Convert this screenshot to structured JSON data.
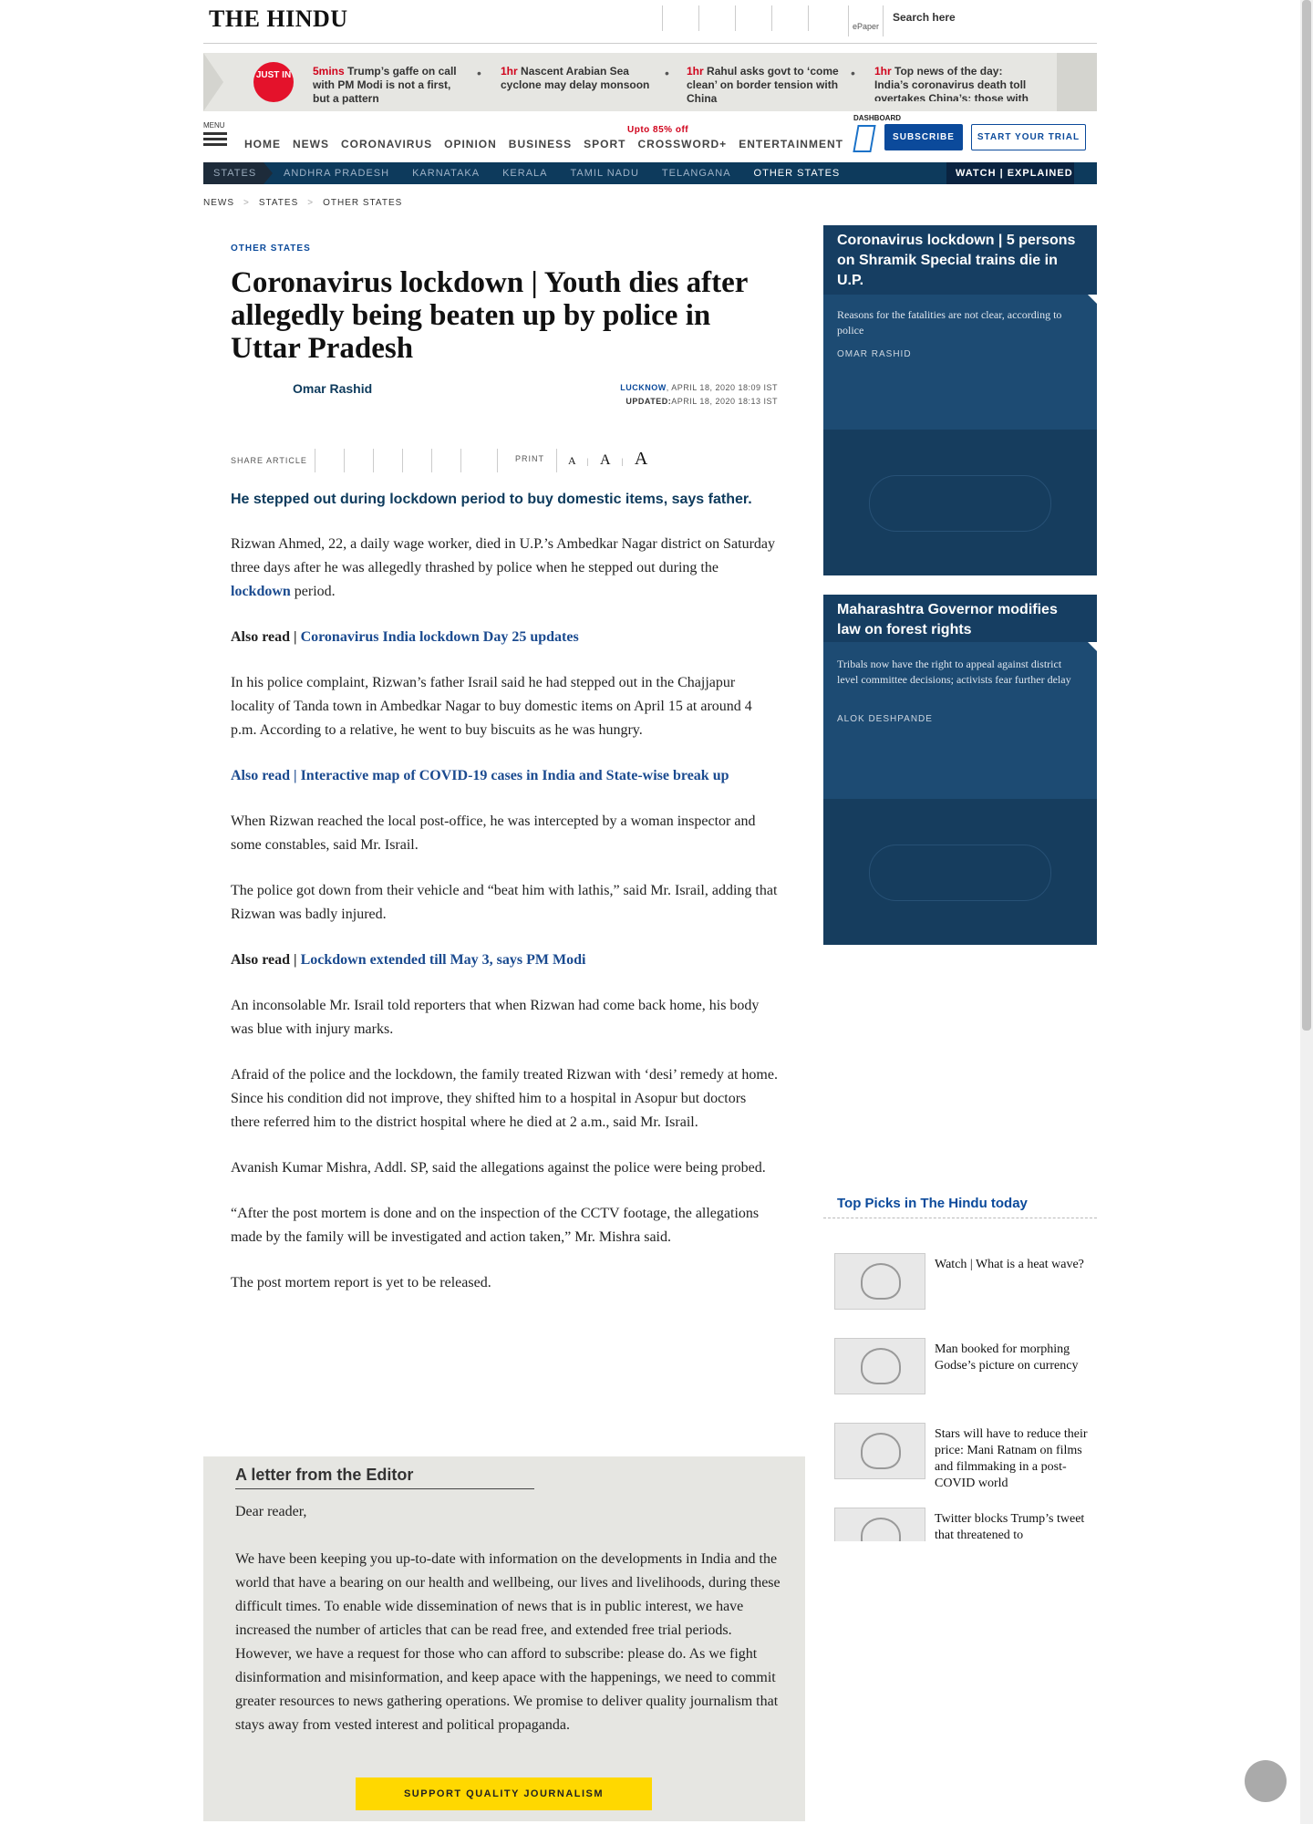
{
  "header": {
    "logo": "THE HINDU",
    "epaper": "ePaper",
    "search_placeholder": "Search here"
  },
  "just_in": {
    "badge": "JUST IN",
    "items": [
      {
        "time": "5mins",
        "text": "Trump’s gaffe on call with PM Modi is not a first, but a pattern"
      },
      {
        "time": "1hr",
        "text": "Nascent Arabian Sea cyclone may delay monsoon"
      },
      {
        "time": "1hr",
        "text": "Rahul asks govt to ‘come clean’ on border tension with China"
      },
      {
        "time": "1hr",
        "text": "Top news of the day: India’s coronavirus death toll overtakes China’s; those with"
      }
    ]
  },
  "nav": {
    "menu_label": "MENU",
    "items": [
      "HOME",
      "NEWS",
      "CORONAVIRUS",
      "OPINION",
      "BUSINESS",
      "SPORT",
      "CROSSWORD+",
      "ENTERTAINMENT"
    ],
    "offer": "Upto 85% off",
    "dashboard": "DASHBOARD",
    "subscribe": "SUBSCRIBE",
    "trial": "START YOUR TRIAL"
  },
  "states_bar": {
    "label": "STATES",
    "items": [
      "ANDHRA PRADESH",
      "KARNATAKA",
      "KERALA",
      "TAMIL NADU",
      "TELANGANA",
      "OTHER STATES"
    ],
    "watch": "WATCH | EXPLAINED"
  },
  "breadcrumb": [
    "NEWS",
    "STATES",
    "OTHER STATES"
  ],
  "article": {
    "section": "OTHER STATES",
    "headline": "Coronavirus lockdown | Youth dies after allegedly being beaten up by police in Uttar Pradesh",
    "author": "Omar Rashid",
    "location": "LUCKNOW",
    "date": ", APRIL 18, 2020 18:09 IST",
    "updated_label": "UPDATED:",
    "updated": "APRIL 18, 2020 18:13 IST",
    "share_label": "SHARE ARTICLE",
    "print_label": "PRINT",
    "font_sizes": [
      "A",
      "A",
      "A"
    ],
    "lead": "He stepped out during lockdown period to buy domestic items, says father.",
    "p1_a": "Rizwan Ahmed, 22, a daily wage worker, died in U.P.’s Ambedkar Nagar district on Saturday three days after he was allegedly thrashed by police when he stepped out during the ",
    "p1_link": "lockdown",
    "p1_b": " period.",
    "also1_label": "Also read | ",
    "also1_link": "Coronavirus India lockdown Day 25 updates",
    "p2": "In his police complaint, Rizwan’s father Israil said he had stepped out in the Chajjapur locality of Tanda town in Ambedkar Nagar to buy domestic items on April 15 at around 4 p.m. According to a relative, he went to buy biscuits as he was hungry.",
    "also2": "Also read | Interactive map of COVID-19 cases in India and State-wise break up",
    "p3": "When Rizwan reached the local post-office, he was intercepted by a woman inspector and some constables, said Mr. Israil.",
    "p4": "The police got down from their vehicle and “beat him with lathis,” said Mr. Israil, adding that Rizwan was badly injured.",
    "also3_label": "Also read | ",
    "also3_link": "Lockdown extended till May 3, says PM Modi",
    "p5": "An inconsolable Mr. Israil told reporters that when Rizwan had come back home, his body was blue with injury marks.",
    "p6": "Afraid of the police and the lockdown, the family treated Rizwan with ‘desi’ remedy at home. Since his condition did not improve, they shifted him to a hospital in Asopur but doctors there referred him to the district hospital where he died at 2 a.m., said Mr. Israil.",
    "p7": "Avanish Kumar Mishra, Addl. SP, said the allegations against the police were being probed.",
    "p8": "“After the post mortem is done and on the inspection of the CCTV footage, the allegations made by the family will be investigated and action taken,” Mr. Mishra said.",
    "p9": "The post mortem report is yet to be released."
  },
  "editor": {
    "title": "A letter from the Editor",
    "greeting": "Dear reader,",
    "body": "We have been keeping you up-to-date with information on the developments in India and the world that have a bearing on our health and wellbeing, our lives and livelihoods, during these difficult times. To enable wide dissemination of news that is in public interest, we have increased the number of articles that can be read free, and extended free trial periods. However, we have a request for those who can afford to subscribe: please do. As we fight disinformation and misinformation, and keep apace with the happenings, we need to commit greater resources to news gathering operations. We promise to deliver quality journalism that stays away from vested interest and political propaganda.",
    "button": "SUPPORT QUALITY JOURNALISM"
  },
  "sidebar": {
    "cards": [
      {
        "title": "Coronavirus lockdown | 5 persons on Shramik Special trains die in U.P.",
        "summary": "Reasons for the fatalities are not clear, according to police",
        "author": "OMAR RASHID"
      },
      {
        "title": "Maharashtra Governor modifies law on forest rights",
        "summary": "Tribals now have the right to appeal against district level committee decisions; activists fear further delay",
        "author": "ALOK DESHPANDE"
      }
    ],
    "picks_title": "Top Picks in The Hindu today",
    "picks": [
      "Watch | What is a heat wave?",
      "Man booked for morphing Godse’s picture on currency",
      "Stars will have to reduce their price: Mani Ratnam on films and filmmaking in a post-COVID world",
      "Twitter blocks Trump’s tweet that threatened to"
    ]
  }
}
